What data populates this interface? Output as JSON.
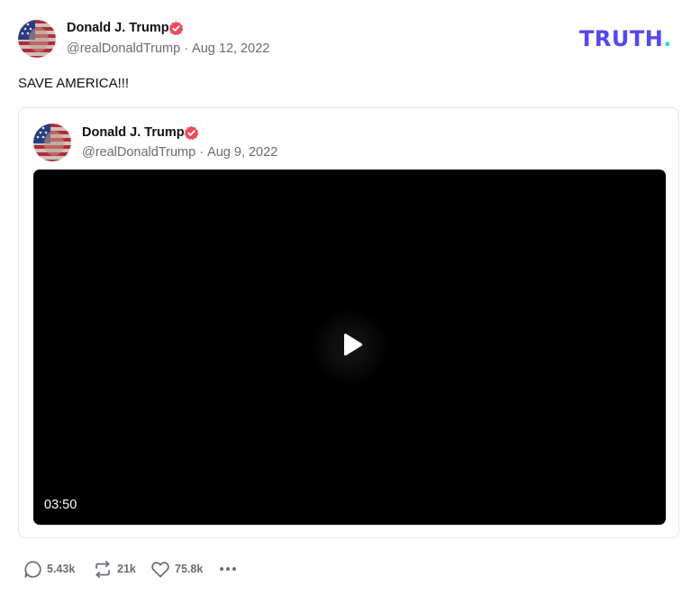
{
  "brand": {
    "logo_text": "TRUTH",
    "logo_dot": ".",
    "logo_color": "#5448ee",
    "logo_dot_color": "#33d6c8"
  },
  "post": {
    "author_name": "Donald J. Trump",
    "handle": "@realDonaldTrump",
    "separator": "·",
    "date": "Aug 12, 2022",
    "text": "SAVE AMERICA!!!",
    "verified_icon": "verified-badge-icon",
    "verified_color": "#ec4b5e"
  },
  "quoted_post": {
    "author_name": "Donald J. Trump",
    "handle": "@realDonaldTrump",
    "separator": "·",
    "date": "Aug 9, 2022",
    "video": {
      "duration": "03:50",
      "play_icon": "play-icon"
    }
  },
  "actions": {
    "replies": "5.43k",
    "reposts": "21k",
    "likes": "75.8k",
    "reply_icon": "comment-icon",
    "repost_icon": "repost-icon",
    "like_icon": "heart-icon",
    "more_icon": "more-dots-icon"
  }
}
